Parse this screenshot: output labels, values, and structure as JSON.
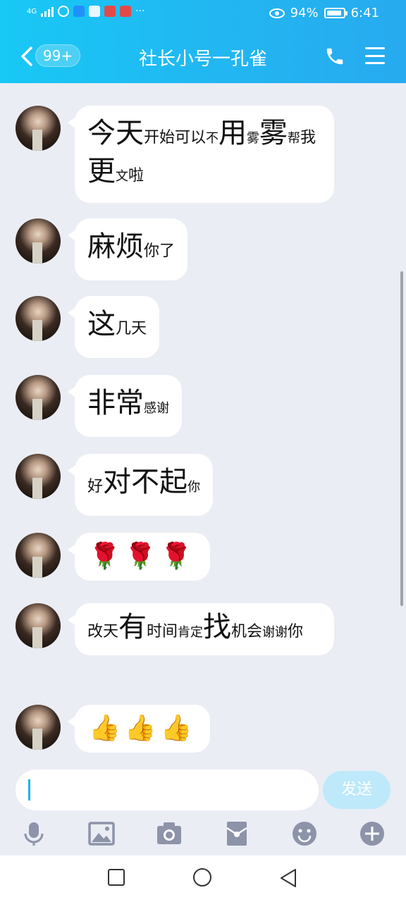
{
  "status": {
    "network": "4G",
    "battery": "94%",
    "time": "6:41",
    "more": "···"
  },
  "header": {
    "unread_badge": "99+",
    "title": "社长小号一孔雀"
  },
  "messages": [
    {
      "id": 1,
      "parts": [
        [
          "今天",
          "big"
        ],
        [
          "开始可以",
          "mid"
        ],
        [
          "不",
          "sm"
        ],
        [
          "用",
          "big"
        ],
        [
          "雾",
          "sm"
        ],
        [
          "雾",
          "big"
        ],
        [
          "帮",
          "sm"
        ],
        [
          "我",
          "mid"
        ],
        [
          "更",
          "big"
        ],
        [
          "文",
          "sm"
        ],
        [
          "啦",
          "mid"
        ]
      ]
    },
    {
      "id": 2,
      "parts": [
        [
          "麻烦",
          "big"
        ],
        [
          "你了",
          "mid"
        ]
      ]
    },
    {
      "id": 3,
      "parts": [
        [
          "这",
          "big"
        ],
        [
          "几天",
          "mid"
        ]
      ]
    },
    {
      "id": 4,
      "parts": [
        [
          "非常",
          "big"
        ],
        [
          "感谢",
          "sm"
        ]
      ]
    },
    {
      "id": 5,
      "parts": [
        [
          "好",
          "mid"
        ],
        [
          "对不起",
          "big"
        ],
        [
          "你",
          "sm"
        ]
      ]
    },
    {
      "id": 6,
      "emoji": "🌹🌹🌹"
    },
    {
      "id": 7,
      "parts": [
        [
          "改天",
          "mid"
        ],
        [
          "有",
          "big"
        ],
        [
          "时间",
          "mid"
        ],
        [
          "肯定",
          "sm"
        ],
        [
          "找",
          "big"
        ],
        [
          "机会",
          "mid"
        ],
        [
          "谢谢",
          "sm"
        ],
        [
          "你",
          "mid"
        ]
      ]
    },
    {
      "id": 8,
      "emoji": "👍👍👍"
    }
  ],
  "input": {
    "value": "",
    "send_label": "发送"
  },
  "icons": {
    "back": "chevron-left-icon",
    "phone": "phone-icon",
    "menu": "menu-icon",
    "tools": [
      "microphone-icon",
      "image-icon",
      "camera-icon",
      "red-envelope-icon",
      "emoji-icon",
      "plus-icon"
    ]
  },
  "colors": {
    "header_start": "#18c8f5",
    "header_end": "#27aaef",
    "chat_bg": "#eaedf4",
    "send_disabled": "#bde9fb",
    "tool_icon": "#8d93a8"
  }
}
